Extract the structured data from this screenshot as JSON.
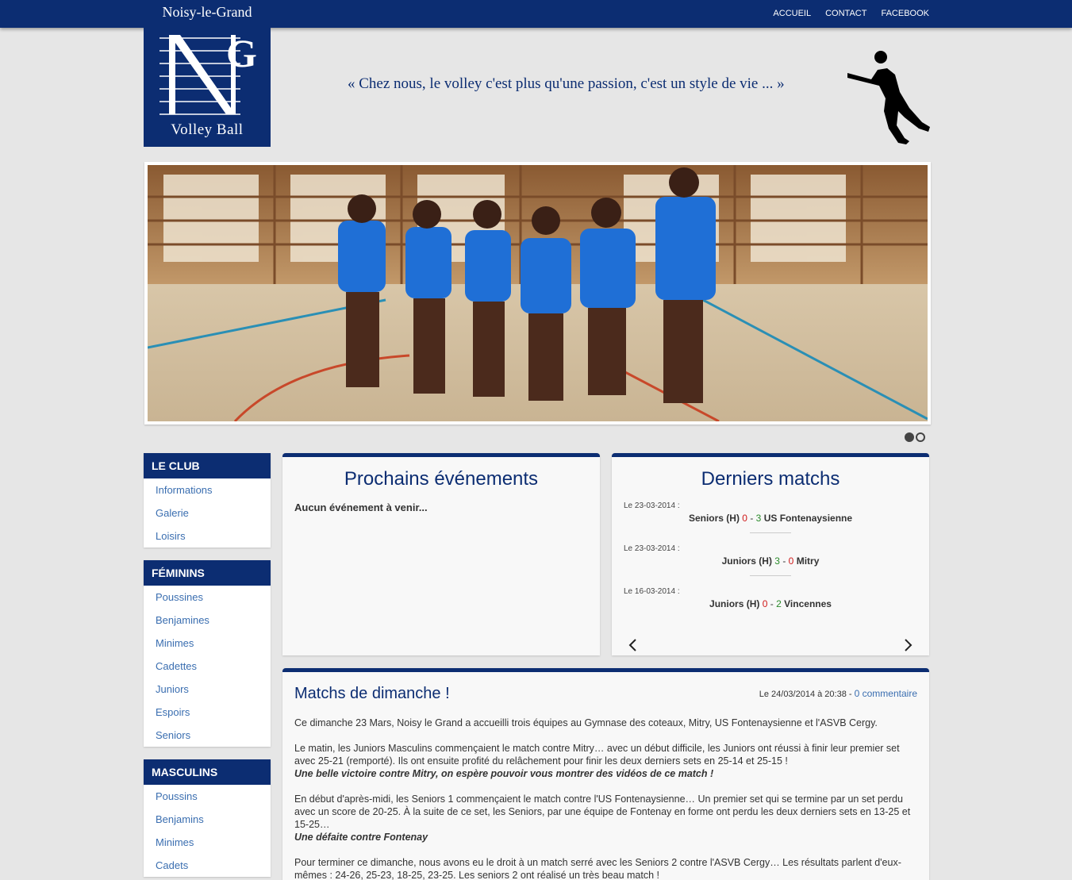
{
  "colors": {
    "brand": "#0c2d72",
    "link": "#3a6eb0",
    "score_red": "#d01a1a",
    "score_green": "#2a8a2a"
  },
  "nav": [
    {
      "label": "ACCUEIL"
    },
    {
      "label": "CONTACT"
    },
    {
      "label": "FACEBOOK"
    }
  ],
  "logo": {
    "city": "Noisy-le-Grand",
    "initials": "NG",
    "sub": "Volley Ball"
  },
  "slogan": "« Chez nous, le volley c'est plus qu'une passion, c'est un style de vie ... »",
  "slider": {
    "slide_count": 2,
    "active_index": 0
  },
  "sidebar": [
    {
      "title": "LE CLUB",
      "items": [
        "Informations",
        "Galerie",
        "Loisirs"
      ]
    },
    {
      "title": "FÉMININS",
      "items": [
        "Poussines",
        "Benjamines",
        "Minimes",
        "Cadettes",
        "Juniors",
        "Espoirs",
        "Seniors"
      ]
    },
    {
      "title": "MASCULINS",
      "items": [
        "Poussins",
        "Benjamins",
        "Minimes",
        "Cadets"
      ]
    }
  ],
  "events": {
    "title": "Prochains événements",
    "empty": "Aucun événement à venir..."
  },
  "matches": {
    "title": "Derniers matchs",
    "items": [
      {
        "date": "Le 23-03-2014 :",
        "home": "Seniors (H)",
        "home_score": "0",
        "sep": "-",
        "away_score": "3",
        "away": "US Fontenaysienne"
      },
      {
        "date": "Le 23-03-2014 :",
        "home": "Juniors (H)",
        "home_score": "3",
        "sep": "-",
        "away_score": "0",
        "away": "Mitry"
      },
      {
        "date": "Le 16-03-2014 :",
        "home": "Juniors (H)",
        "home_score": "0",
        "sep": "-",
        "away_score": "2",
        "away": "Vincennes"
      }
    ]
  },
  "article": {
    "title": "Matchs de dimanche !",
    "meta": "Le 24/03/2014 à 20:38 -",
    "comments": "0 commentaire",
    "p1": "Ce dimanche 23 Mars, Noisy le Grand a accueilli trois équipes au Gymnase des coteaux, Mitry, US Fontenaysienne et l'ASVB Cergy.",
    "p2": "Le matin, les Juniors Masculins commençaient le match contre Mitry… avec un début difficile, les Juniors ont réussi à finir leur premier set avec 25-21 (remporté). Ils ont ensuite profité du relâchement pour finir les deux derniers sets en 25-14 et 25-15 !",
    "p2_em": "Une belle victoire contre Mitry, on espère pouvoir vous montrer des vidéos de ce match !",
    "p3": "En début d'après-midi, les Seniors 1 commençaient le match contre l'US Fontenaysienne… Un premier set qui se termine par un set perdu avec un score de 20-25. À la suite de ce set, les Seniors, par une équipe de Fontenay en forme ont perdu les deux derniers sets en 13-25 et 15-25…",
    "p3_em": "Une défaite contre Fontenay",
    "p4": "Pour terminer ce dimanche, nous avons eu le droit à un match serré avec les Seniors 2 contre l'ASVB Cergy… Les résultats parlent d'eux-mêmes : 24-26, 25-23, 18-25, 23-25. Les seniors 2 ont réalisé un très beau match !"
  }
}
